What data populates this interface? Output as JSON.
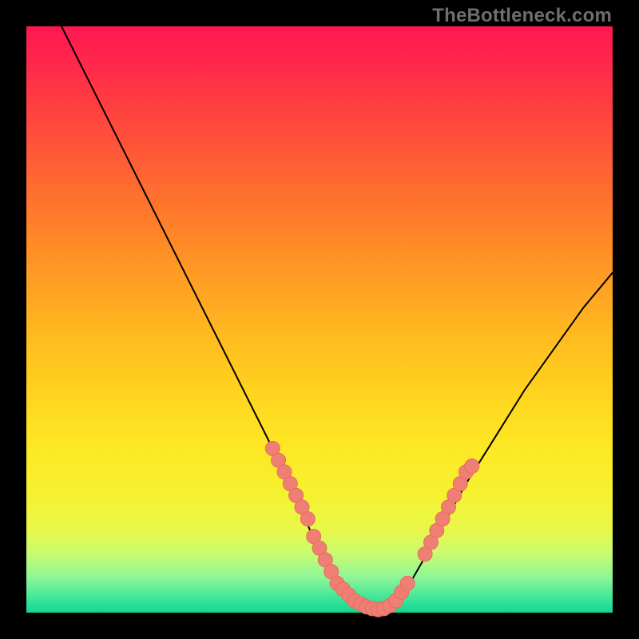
{
  "watermark": "TheBottleneck.com",
  "chart_data": {
    "type": "line",
    "title": "",
    "xlabel": "",
    "ylabel": "",
    "xlim": [
      0,
      100
    ],
    "ylim": [
      0,
      100
    ],
    "series": [
      {
        "name": "curve",
        "x": [
          6,
          10,
          15,
          20,
          25,
          30,
          35,
          40,
          45,
          48,
          50,
          52,
          55,
          58,
          60,
          62,
          64,
          66,
          70,
          75,
          80,
          85,
          90,
          95,
          100
        ],
        "y": [
          100,
          92,
          82,
          72,
          62,
          52,
          42,
          32,
          22,
          15,
          10,
          6,
          3,
          1,
          0,
          1,
          3,
          6,
          13,
          22,
          30,
          38,
          45,
          52,
          58
        ]
      }
    ],
    "highlights": [
      {
        "name": "left-slope-markers",
        "points": [
          {
            "x": 42,
            "y": 28
          },
          {
            "x": 43,
            "y": 26
          },
          {
            "x": 44,
            "y": 24
          },
          {
            "x": 45,
            "y": 22
          },
          {
            "x": 46,
            "y": 20
          },
          {
            "x": 47,
            "y": 18
          },
          {
            "x": 48,
            "y": 16
          },
          {
            "x": 49,
            "y": 13
          }
        ]
      },
      {
        "name": "valley-markers",
        "points": [
          {
            "x": 50,
            "y": 11
          },
          {
            "x": 51,
            "y": 9
          },
          {
            "x": 52,
            "y": 7
          },
          {
            "x": 53,
            "y": 5
          },
          {
            "x": 54,
            "y": 4
          },
          {
            "x": 55,
            "y": 3
          },
          {
            "x": 56,
            "y": 2
          },
          {
            "x": 57,
            "y": 1.5
          },
          {
            "x": 58,
            "y": 1
          },
          {
            "x": 59,
            "y": 0.7
          },
          {
            "x": 60,
            "y": 0.5
          },
          {
            "x": 61,
            "y": 0.7
          },
          {
            "x": 62,
            "y": 1.2
          },
          {
            "x": 63,
            "y": 2
          },
          {
            "x": 64,
            "y": 3.5
          },
          {
            "x": 65,
            "y": 5
          }
        ]
      },
      {
        "name": "right-slope-markers",
        "points": [
          {
            "x": 68,
            "y": 10
          },
          {
            "x": 69,
            "y": 12
          },
          {
            "x": 70,
            "y": 14
          },
          {
            "x": 71,
            "y": 16
          },
          {
            "x": 72,
            "y": 18
          },
          {
            "x": 73,
            "y": 20
          },
          {
            "x": 74,
            "y": 22
          },
          {
            "x": 75,
            "y": 24
          },
          {
            "x": 76,
            "y": 25
          }
        ]
      }
    ],
    "colors": {
      "curve": "#000000",
      "marker_fill": "#ef7f74",
      "marker_stroke": "#e86b5e"
    }
  }
}
